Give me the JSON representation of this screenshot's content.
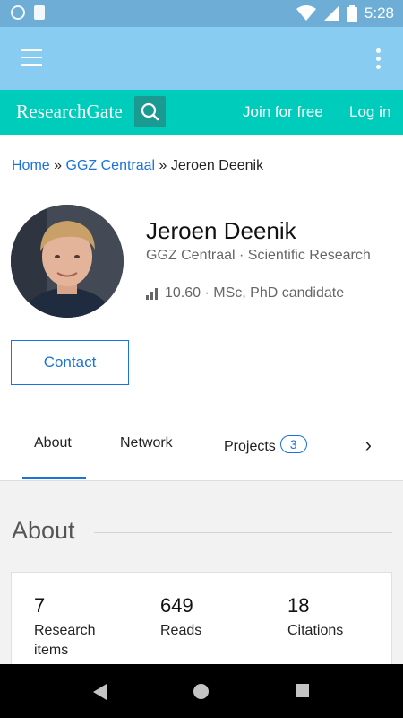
{
  "status_bar": {
    "time": "5:28"
  },
  "researchgate": {
    "logo": "ResearchGate",
    "join_label": "Join for free",
    "login_label": "Log in"
  },
  "breadcrumb": {
    "home": "Home",
    "separator": "»",
    "institution": "GGZ Centraal",
    "current": "Jeroen Deenik"
  },
  "profile": {
    "name": "Jeroen Deenik",
    "institution_line": "GGZ Centraal · Scientific Research",
    "score_line": "10.60 · MSc, PhD candidate",
    "contact_label": "Contact"
  },
  "tabs": [
    {
      "label": "About",
      "active": true
    },
    {
      "label": "Network"
    },
    {
      "label": "Projects",
      "badge": "3"
    }
  ],
  "about": {
    "title": "About",
    "stats": [
      {
        "value": "7",
        "label": "Research items"
      },
      {
        "value": "649",
        "label": "Reads"
      },
      {
        "value": "18",
        "label": "Citations"
      }
    ]
  },
  "colors": {
    "status_bar": "#6eaed6",
    "app_bar": "#89ccf1",
    "brand_teal": "#00ccbb",
    "link_blue": "#1a73d9"
  }
}
